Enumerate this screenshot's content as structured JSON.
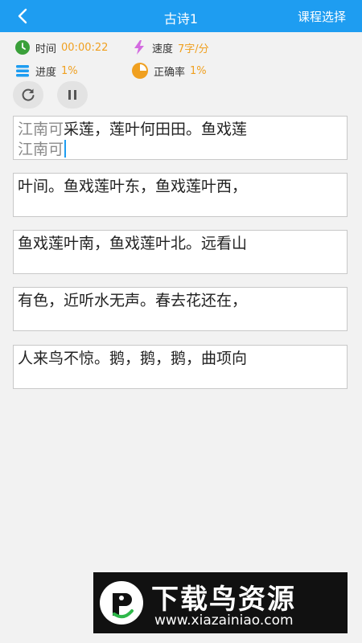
{
  "header": {
    "title": "古诗1",
    "course_select": "课程选择"
  },
  "stats": {
    "time_label": "时间",
    "time_value": "00:00:22",
    "speed_label": "速度",
    "speed_value": "7字/分",
    "progress_label": "进度",
    "progress_value": "1%",
    "accuracy_label": "正确率",
    "accuracy_value": "1%"
  },
  "lines": [
    {
      "typed": "江南可",
      "rest": "采莲，莲叶何田田。鱼戏莲",
      "input": "江南可"
    },
    {
      "typed": "",
      "rest": "叶间。鱼戏莲叶东，鱼戏莲叶西，",
      "input": ""
    },
    {
      "typed": "",
      "rest": "鱼戏莲叶南，鱼戏莲叶北。远看山",
      "input": ""
    },
    {
      "typed": "",
      "rest": "有色，近听水无声。春去花还在，",
      "input": ""
    },
    {
      "typed": "",
      "rest": "人来鸟不惊。鹅，鹅，鹅，曲项向",
      "input": ""
    }
  ],
  "banner": {
    "brand": "下载鸟资源",
    "url": "www.xiazainiao.com"
  },
  "colors": {
    "header_bg": "#1e9df1",
    "accent_value": "#f0a020",
    "time_icon": "#3aa03a",
    "speed_icon": "#d36be0",
    "progress_icon": "#1e9df1",
    "accuracy_icon": "#f0a020"
  }
}
